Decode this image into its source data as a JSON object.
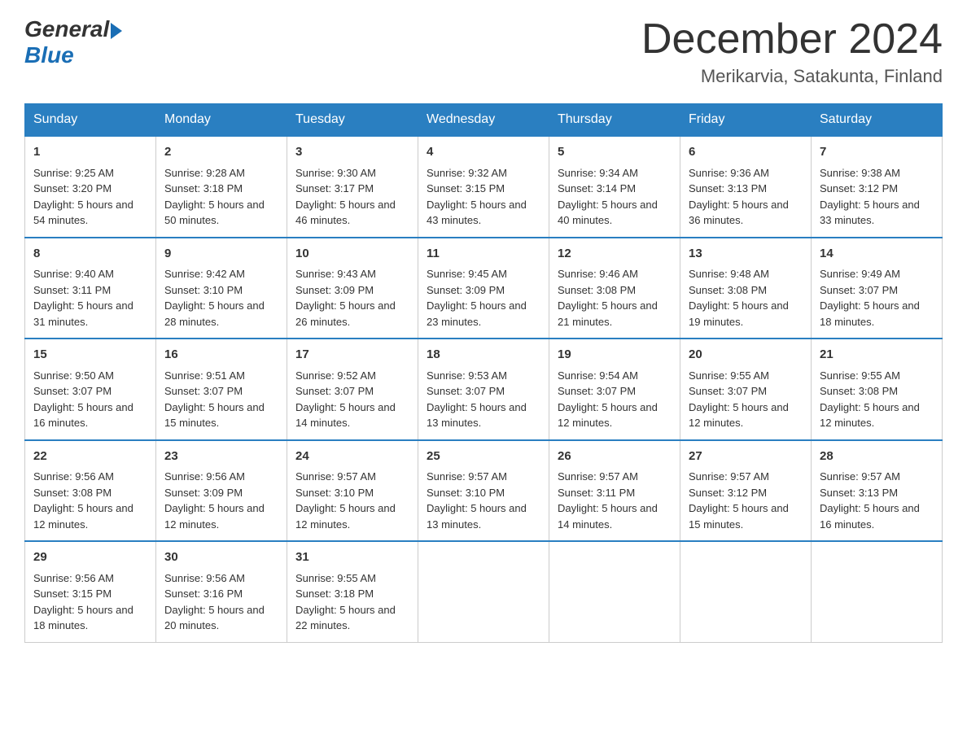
{
  "header": {
    "logo": {
      "general": "General",
      "blue": "Blue"
    },
    "title": "December 2024",
    "subtitle": "Merikarvia, Satakunta, Finland"
  },
  "days_header": [
    "Sunday",
    "Monday",
    "Tuesday",
    "Wednesday",
    "Thursday",
    "Friday",
    "Saturday"
  ],
  "weeks": [
    [
      {
        "day": "1",
        "sunrise": "9:25 AM",
        "sunset": "3:20 PM",
        "daylight": "5 hours and 54 minutes."
      },
      {
        "day": "2",
        "sunrise": "9:28 AM",
        "sunset": "3:18 PM",
        "daylight": "5 hours and 50 minutes."
      },
      {
        "day": "3",
        "sunrise": "9:30 AM",
        "sunset": "3:17 PM",
        "daylight": "5 hours and 46 minutes."
      },
      {
        "day": "4",
        "sunrise": "9:32 AM",
        "sunset": "3:15 PM",
        "daylight": "5 hours and 43 minutes."
      },
      {
        "day": "5",
        "sunrise": "9:34 AM",
        "sunset": "3:14 PM",
        "daylight": "5 hours and 40 minutes."
      },
      {
        "day": "6",
        "sunrise": "9:36 AM",
        "sunset": "3:13 PM",
        "daylight": "5 hours and 36 minutes."
      },
      {
        "day": "7",
        "sunrise": "9:38 AM",
        "sunset": "3:12 PM",
        "daylight": "5 hours and 33 minutes."
      }
    ],
    [
      {
        "day": "8",
        "sunrise": "9:40 AM",
        "sunset": "3:11 PM",
        "daylight": "5 hours and 31 minutes."
      },
      {
        "day": "9",
        "sunrise": "9:42 AM",
        "sunset": "3:10 PM",
        "daylight": "5 hours and 28 minutes."
      },
      {
        "day": "10",
        "sunrise": "9:43 AM",
        "sunset": "3:09 PM",
        "daylight": "5 hours and 26 minutes."
      },
      {
        "day": "11",
        "sunrise": "9:45 AM",
        "sunset": "3:09 PM",
        "daylight": "5 hours and 23 minutes."
      },
      {
        "day": "12",
        "sunrise": "9:46 AM",
        "sunset": "3:08 PM",
        "daylight": "5 hours and 21 minutes."
      },
      {
        "day": "13",
        "sunrise": "9:48 AM",
        "sunset": "3:08 PM",
        "daylight": "5 hours and 19 minutes."
      },
      {
        "day": "14",
        "sunrise": "9:49 AM",
        "sunset": "3:07 PM",
        "daylight": "5 hours and 18 minutes."
      }
    ],
    [
      {
        "day": "15",
        "sunrise": "9:50 AM",
        "sunset": "3:07 PM",
        "daylight": "5 hours and 16 minutes."
      },
      {
        "day": "16",
        "sunrise": "9:51 AM",
        "sunset": "3:07 PM",
        "daylight": "5 hours and 15 minutes."
      },
      {
        "day": "17",
        "sunrise": "9:52 AM",
        "sunset": "3:07 PM",
        "daylight": "5 hours and 14 minutes."
      },
      {
        "day": "18",
        "sunrise": "9:53 AM",
        "sunset": "3:07 PM",
        "daylight": "5 hours and 13 minutes."
      },
      {
        "day": "19",
        "sunrise": "9:54 AM",
        "sunset": "3:07 PM",
        "daylight": "5 hours and 12 minutes."
      },
      {
        "day": "20",
        "sunrise": "9:55 AM",
        "sunset": "3:07 PM",
        "daylight": "5 hours and 12 minutes."
      },
      {
        "day": "21",
        "sunrise": "9:55 AM",
        "sunset": "3:08 PM",
        "daylight": "5 hours and 12 minutes."
      }
    ],
    [
      {
        "day": "22",
        "sunrise": "9:56 AM",
        "sunset": "3:08 PM",
        "daylight": "5 hours and 12 minutes."
      },
      {
        "day": "23",
        "sunrise": "9:56 AM",
        "sunset": "3:09 PM",
        "daylight": "5 hours and 12 minutes."
      },
      {
        "day": "24",
        "sunrise": "9:57 AM",
        "sunset": "3:10 PM",
        "daylight": "5 hours and 12 minutes."
      },
      {
        "day": "25",
        "sunrise": "9:57 AM",
        "sunset": "3:10 PM",
        "daylight": "5 hours and 13 minutes."
      },
      {
        "day": "26",
        "sunrise": "9:57 AM",
        "sunset": "3:11 PM",
        "daylight": "5 hours and 14 minutes."
      },
      {
        "day": "27",
        "sunrise": "9:57 AM",
        "sunset": "3:12 PM",
        "daylight": "5 hours and 15 minutes."
      },
      {
        "day": "28",
        "sunrise": "9:57 AM",
        "sunset": "3:13 PM",
        "daylight": "5 hours and 16 minutes."
      }
    ],
    [
      {
        "day": "29",
        "sunrise": "9:56 AM",
        "sunset": "3:15 PM",
        "daylight": "5 hours and 18 minutes."
      },
      {
        "day": "30",
        "sunrise": "9:56 AM",
        "sunset": "3:16 PM",
        "daylight": "5 hours and 20 minutes."
      },
      {
        "day": "31",
        "sunrise": "9:55 AM",
        "sunset": "3:18 PM",
        "daylight": "5 hours and 22 minutes."
      },
      null,
      null,
      null,
      null
    ]
  ]
}
